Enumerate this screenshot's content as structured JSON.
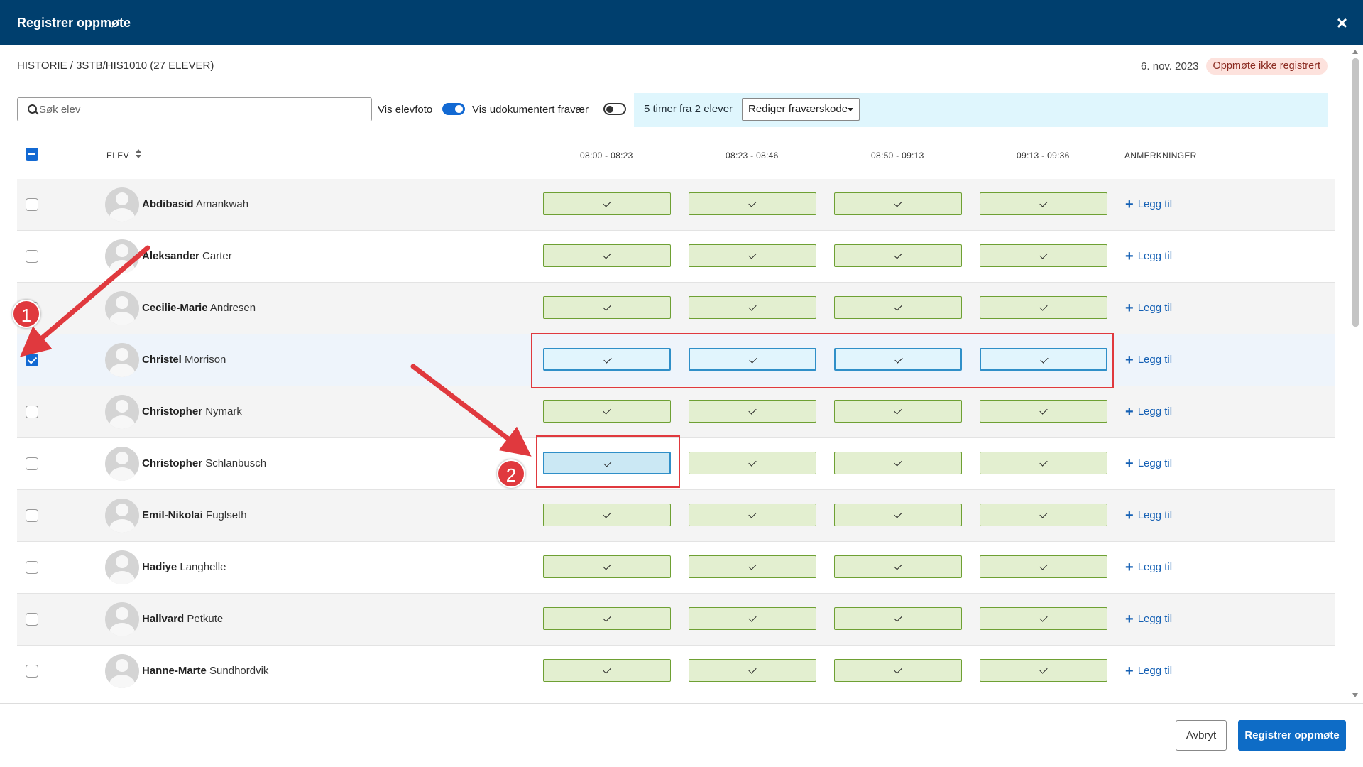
{
  "dialog": {
    "title": "Registrer oppmøte",
    "close_label": "×"
  },
  "breadcrumb": "HISTORIE / 3STB/HIS1010 (27 ELEVER)",
  "date": "6. nov. 2023",
  "status_badge": "Oppmøte ikke registrert",
  "search": {
    "placeholder": "Søk elev"
  },
  "toggles": {
    "show_photo_label": "Vis elevfoto",
    "show_photo_on": true,
    "show_undoc_label": "Vis udokumentert fravær",
    "show_undoc_on": false
  },
  "infobar": {
    "text": "5 timer fra 2 elever",
    "select_label": "Rediger fraværskode"
  },
  "columns": {
    "student": "ELEV",
    "slots": [
      "08:00 - 08:23",
      "08:23 - 08:46",
      "08:50 - 09:13",
      "09:13 - 09:36"
    ],
    "remarks": "ANMERKNINGER"
  },
  "add_label": "Legg til",
  "students": [
    {
      "first": "Abdibasid",
      "last": "Amankwah",
      "checked": false
    },
    {
      "first": "Aleksander",
      "last": "Carter",
      "checked": false
    },
    {
      "first": "Cecilie-Marie",
      "last": "Andresen",
      "checked": false
    },
    {
      "first": "Christel",
      "last": "Morrison",
      "checked": true
    },
    {
      "first": "Christopher",
      "last": "Nymark",
      "checked": false
    },
    {
      "first": "Christopher",
      "last": "Schlanbusch",
      "checked": false
    },
    {
      "first": "Emil-Nikolai",
      "last": "Fuglseth",
      "checked": false
    },
    {
      "first": "Hadiye",
      "last": "Langhelle",
      "checked": false
    },
    {
      "first": "Hallvard",
      "last": "Petkute",
      "checked": false
    },
    {
      "first": "Hanne-Marte",
      "last": "Sundhordvik",
      "checked": false
    }
  ],
  "annotations": [
    "1",
    "2"
  ],
  "footer": {
    "cancel_label": "Avbryt",
    "submit_label": "Registrer oppmøte"
  }
}
